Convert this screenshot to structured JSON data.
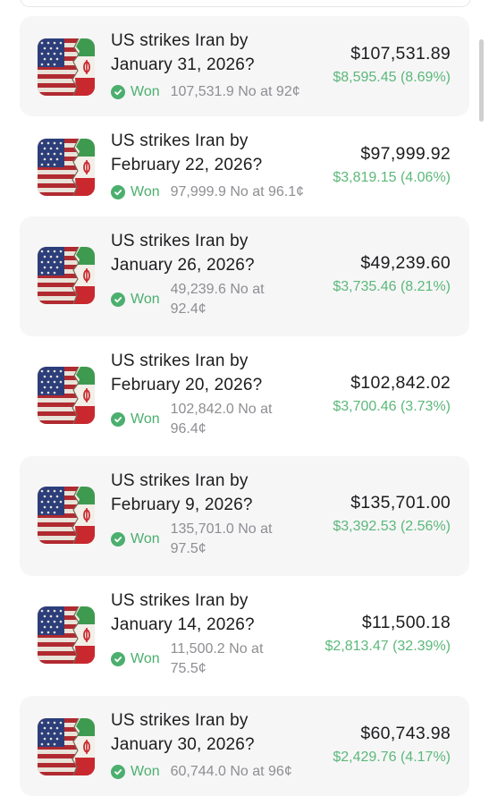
{
  "items": [
    {
      "title": "US strikes Iran by January 31, 2026?",
      "status": "Won",
      "detail": "107,531.9 No at 92¢",
      "amount": "$107,531.89",
      "gain": "$8,595.45 (8.69%)"
    },
    {
      "title": "US strikes Iran by February 22, 2026?",
      "status": "Won",
      "detail": "97,999.9 No at 96.1¢",
      "amount": "$97,999.92",
      "gain": "$3,819.15 (4.06%)"
    },
    {
      "title": "US strikes Iran by January 26, 2026?",
      "status": "Won",
      "detail": "49,239.6 No at 92.4¢",
      "amount": "$49,239.60",
      "gain": "$3,735.46 (8.21%)"
    },
    {
      "title": "US strikes Iran by February 20, 2026?",
      "status": "Won",
      "detail": "102,842.0 No at 96.4¢",
      "amount": "$102,842.02",
      "gain": "$3,700.46 (3.73%)"
    },
    {
      "title": "US strikes Iran by February 9, 2026?",
      "status": "Won",
      "detail": "135,701.0 No at 97.5¢",
      "amount": "$135,701.00",
      "gain": "$3,392.53 (2.56%)"
    },
    {
      "title": "US strikes Iran by January 14, 2026?",
      "status": "Won",
      "detail": "11,500.2 No at 75.5¢",
      "amount": "$11,500.18",
      "gain": "$2,813.47 (32.39%)"
    },
    {
      "title": "US strikes Iran by January 30, 2026?",
      "status": "Won",
      "detail": "60,744.0 No at 96¢",
      "amount": "$60,743.98",
      "gain": "$2,429.76 (4.17%)"
    }
  ],
  "colors": {
    "won": "#4caf6e",
    "gain": "#5cb87a",
    "card": "#f6f6f7"
  },
  "icons": {
    "flag": "us-iran-flag-icon",
    "check": "check-circle-icon"
  }
}
